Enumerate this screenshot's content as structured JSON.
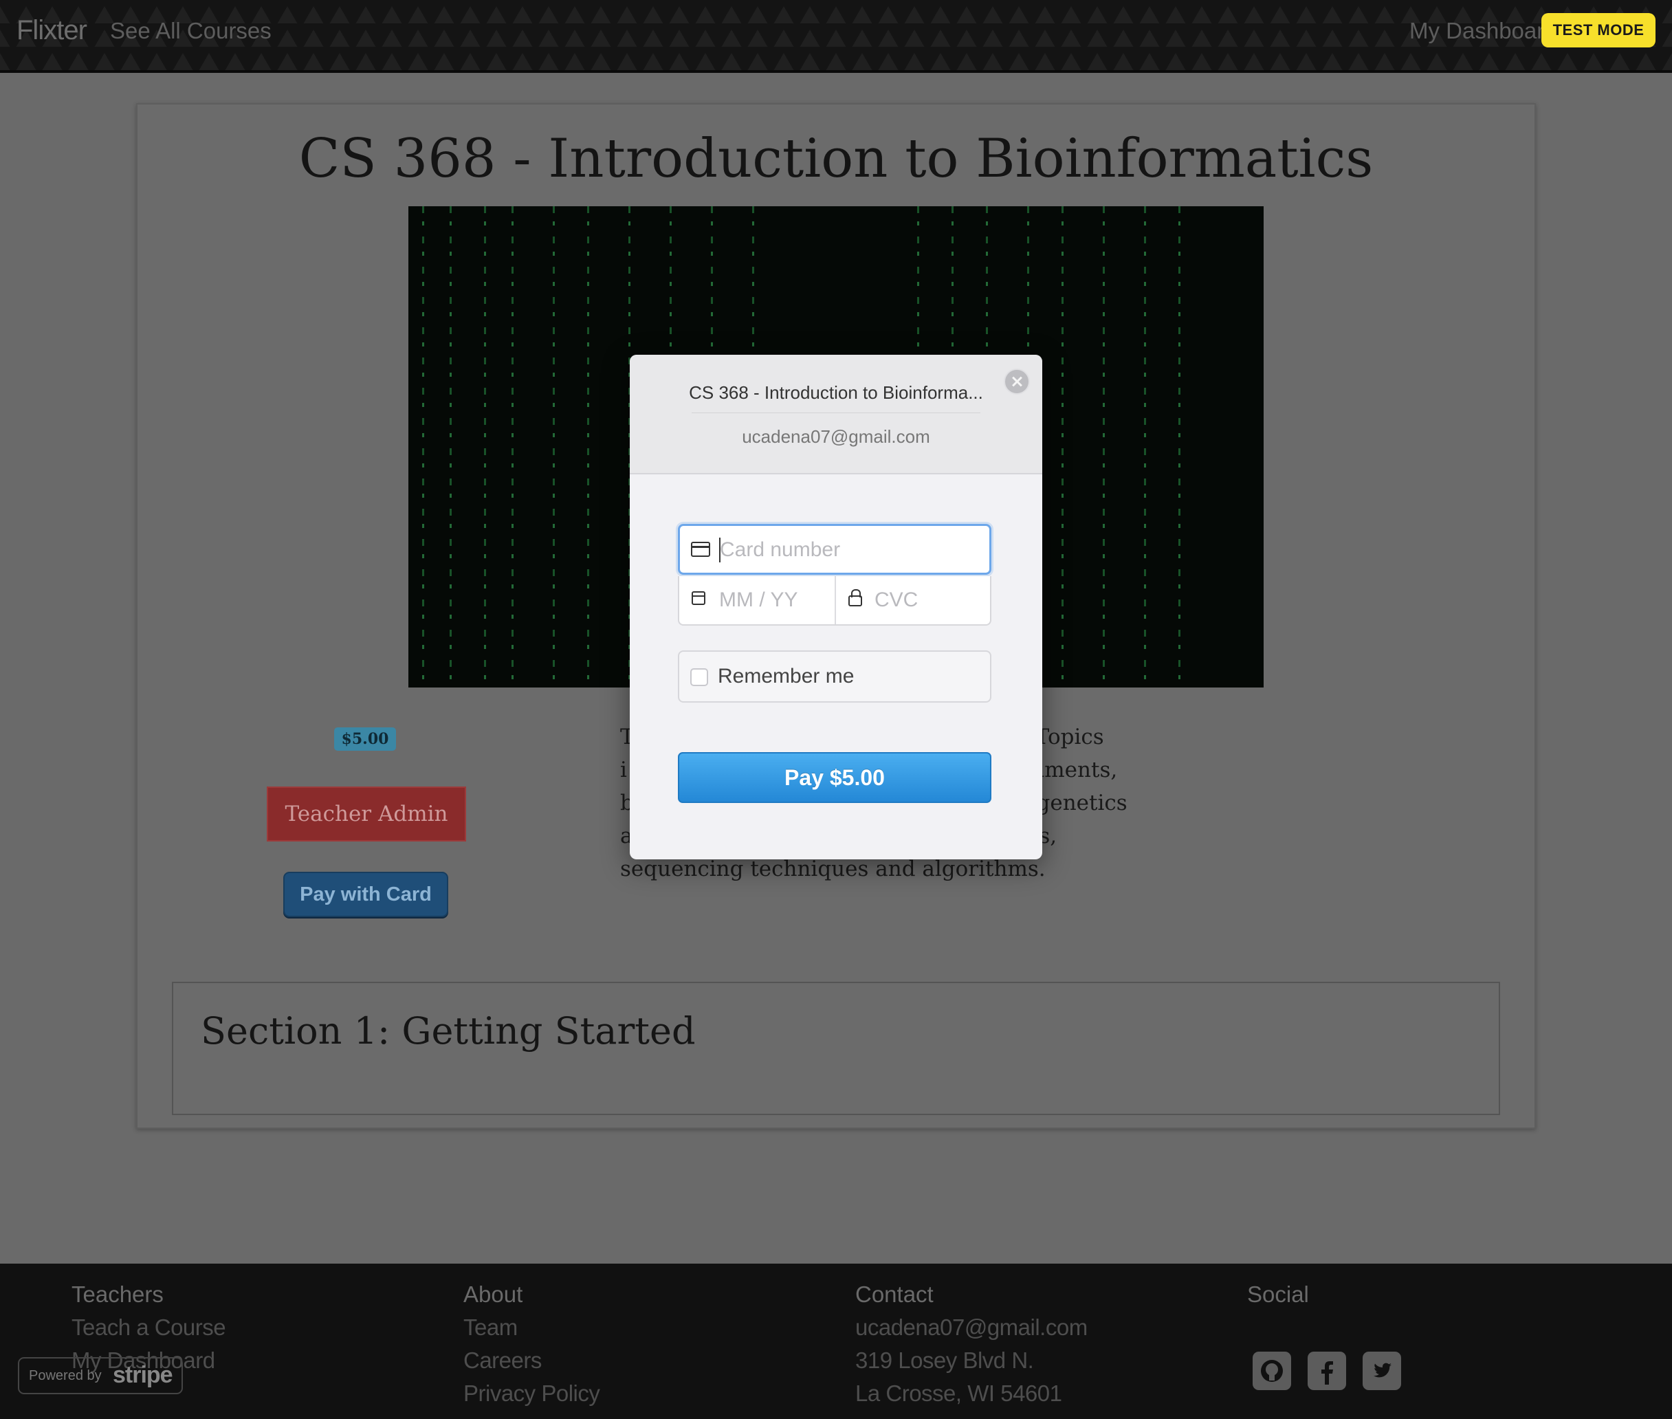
{
  "navbar": {
    "brand": "Flixter",
    "see_all_courses": "See All Courses",
    "my_dashboard": "My Dashboard",
    "test_mode": "TEST MODE"
  },
  "course": {
    "title": "CS 368 - Introduction to Bioinformatics",
    "price": "$5.00",
    "teacher_admin": "Teacher Admin",
    "pay_with_card": "Pay with Card",
    "description_lines": [
      "T                                                         amental concepts of bioinformatics. Topics",
      "i                                                          l informatics, pairwise sequence alignments,",
      "b                                                          s tools and database searches, phylogenetics",
      "a                                                          roduction to DNA microarray analysis,",
      "sequencing techniques and algorithms."
    ],
    "section_title": "Section 1: Getting Started"
  },
  "modal": {
    "title": "CS 368 - Introduction to Bioinforma...",
    "email": "ucadena07@gmail.com",
    "card_number_placeholder": "Card number",
    "expiry_placeholder": "MM / YY",
    "cvc_placeholder": "CVC",
    "remember_me": "Remember me",
    "pay_button": "Pay $5.00"
  },
  "footer": {
    "teachers": {
      "heading": "Teachers",
      "links": [
        "Teach a Course",
        "My Dashboard"
      ]
    },
    "about": {
      "heading": "About",
      "links": [
        "Team",
        "Careers",
        "Privacy Policy"
      ]
    },
    "contact": {
      "heading": "Contact",
      "lines": [
        "ucadena07@gmail.com",
        "319 Losey Blvd N.",
        "La Crosse, WI 54601"
      ]
    },
    "social": {
      "heading": "Social",
      "icons": [
        "github-icon",
        "facebook-icon",
        "twitter-icon"
      ]
    },
    "stripe_badge": {
      "powered_by": "Powered by",
      "brand": "stripe"
    }
  }
}
